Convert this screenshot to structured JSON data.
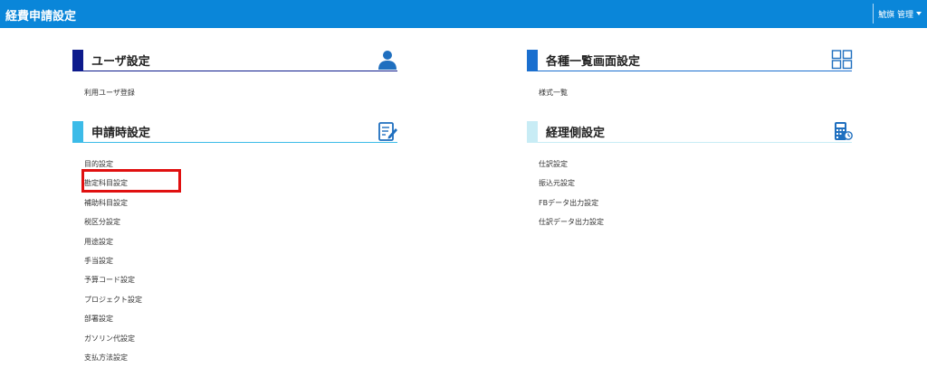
{
  "header": {
    "title": "経費申請設定",
    "user_menu": "鯱旗 管理"
  },
  "colors": {
    "header_bg": "#0a86d9",
    "user_section": "#0d1b8c",
    "apply_section": "#3cbbe8",
    "list_section": "#1a6fcf",
    "accounting_section": "#c8ecf5",
    "highlight": "#e01010"
  },
  "sections": {
    "user": {
      "title": "ユーザ設定",
      "icon": "user-icon",
      "items": [
        "利用ユーザ登録"
      ]
    },
    "apply": {
      "title": "申請時設定",
      "icon": "edit-document-icon",
      "items": [
        "目的設定",
        "勘定科目設定",
        "補助科目設定",
        "税区分設定",
        "用途設定",
        "手当設定",
        "予算コード設定",
        "プロジェクト設定",
        "部署設定",
        "ガソリン代設定",
        "支払方法設定"
      ]
    },
    "list": {
      "title": "各種一覧画面設定",
      "icon": "grid-icon",
      "items": [
        "様式一覧"
      ]
    },
    "accounting": {
      "title": "経理側設定",
      "icon": "calculator-icon",
      "items": [
        "仕訳設定",
        "振込元設定",
        "FBデータ出力設定",
        "仕訳データ出力設定"
      ]
    }
  }
}
